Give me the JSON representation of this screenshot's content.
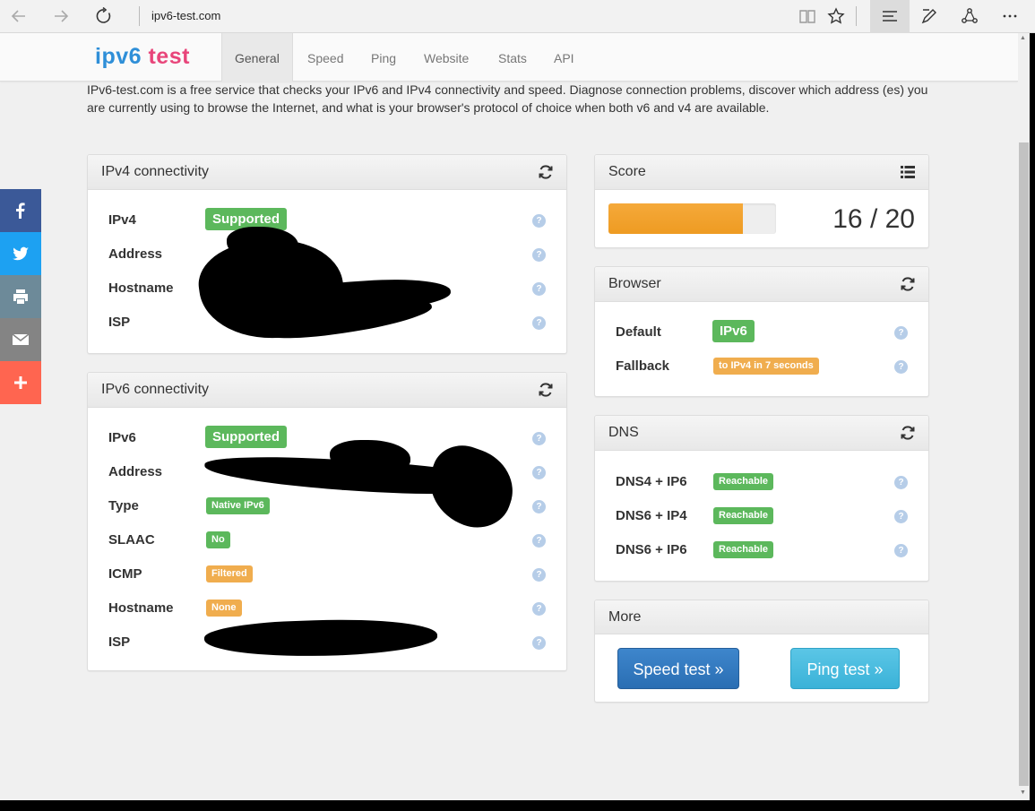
{
  "browser": {
    "url": "ipv6-test.com"
  },
  "site": {
    "logo_a": "ipv6",
    "logo_b": "test",
    "nav": [
      {
        "label": "General"
      },
      {
        "label": "Speed"
      },
      {
        "label": "Ping"
      },
      {
        "label": "Website"
      },
      {
        "label": "Stats"
      },
      {
        "label": "API"
      }
    ],
    "intro": "IPv6-test.com is a free service that checks your IPv6 and IPv4 connectivity and speed. Diagnose connection problems, discover which address (es) you are currently using to browse the Internet, and what is your browser's protocol of choice when both v6 and v4 are available."
  },
  "social": [
    {
      "icon": "facebook-icon",
      "color": "#3b5998"
    },
    {
      "icon": "twitter-icon",
      "color": "#1da1f2"
    },
    {
      "icon": "print-icon",
      "color": "#6d8a99"
    },
    {
      "icon": "email-icon",
      "color": "#848484"
    },
    {
      "icon": "plus-icon",
      "color": "#ff6550"
    }
  ],
  "ipv4": {
    "title": "IPv4 connectivity",
    "rows": [
      {
        "label": "IPv4",
        "badge": "Supported"
      },
      {
        "label": "Address"
      },
      {
        "label": "Hostname"
      },
      {
        "label": "ISP"
      }
    ]
  },
  "ipv6": {
    "title": "IPv6 connectivity",
    "rows": [
      {
        "label": "IPv6",
        "badge": "Supported"
      },
      {
        "label": "Address"
      },
      {
        "label": "Type",
        "badge": "Native IPv6"
      },
      {
        "label": "SLAAC",
        "badge": "No"
      },
      {
        "label": "ICMP",
        "badge": "Filtered"
      },
      {
        "label": "Hostname",
        "badge": "None"
      },
      {
        "label": "ISP"
      }
    ]
  },
  "score": {
    "title": "Score",
    "value": "16 / 20",
    "fraction": 0.8
  },
  "browser_panel": {
    "title": "Browser",
    "rows": [
      {
        "label": "Default",
        "badge": "IPv6"
      },
      {
        "label": "Fallback",
        "badge": "to IPv4 in 7 seconds"
      }
    ]
  },
  "dns": {
    "title": "DNS",
    "rows": [
      {
        "label": "DNS4 + IP6",
        "badge": "Reachable"
      },
      {
        "label": "DNS6 + IP4",
        "badge": "Reachable"
      },
      {
        "label": "DNS6 + IP6",
        "badge": "Reachable"
      }
    ]
  },
  "more": {
    "title": "More",
    "speed_button": "Speed test »",
    "ping_button": "Ping test »"
  },
  "help_glyph": "?",
  "colors": {
    "success": "#5cb85c",
    "warning": "#f0ad4e",
    "progress": "#ee9b22",
    "primary": "#2a6eb3",
    "info": "#3ab2d8"
  }
}
